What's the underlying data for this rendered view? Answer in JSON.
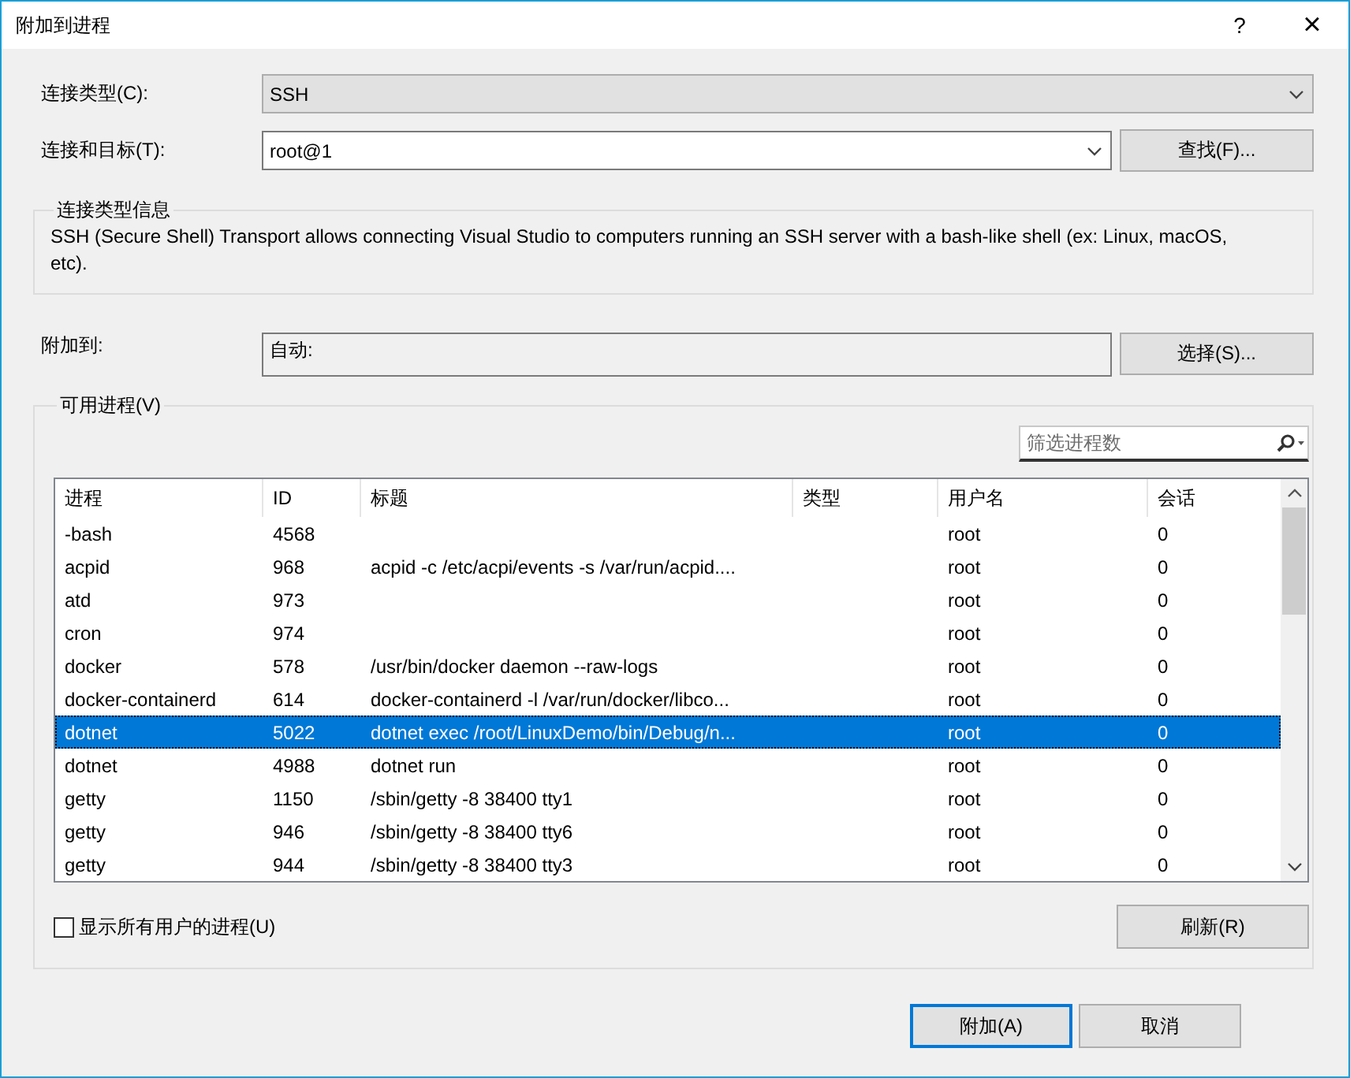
{
  "window": {
    "title": "附加到进程",
    "help": "?",
    "close": "×"
  },
  "connection_type": {
    "label": "连接类型(C):",
    "value": "SSH"
  },
  "connection_target": {
    "label": "连接和目标(T):",
    "value": "root@1",
    "button": "查找(F)..."
  },
  "info_group": {
    "title": "连接类型信息",
    "text": "SSH (Secure Shell) Transport allows connecting Visual Studio to computers running an SSH server with a bash-like shell (ex: Linux, macOS, etc)."
  },
  "attach_to": {
    "label": "附加到:",
    "value": "自动:",
    "button": "选择(S)..."
  },
  "processes_group": {
    "title": "可用进程(V)",
    "filter": {
      "placeholder": "筛选进程数"
    },
    "table": {
      "columns": [
        "进程",
        "ID",
        "标题",
        "类型",
        "用户名",
        "会话"
      ],
      "rows": [
        {
          "cells": [
            "-bash",
            "4568",
            "",
            "",
            "root",
            "0"
          ],
          "selected": false
        },
        {
          "cells": [
            "acpid",
            "968",
            "acpid -c /etc/acpi/events -s /var/run/acpid....",
            "",
            "root",
            "0"
          ],
          "selected": false
        },
        {
          "cells": [
            "atd",
            "973",
            "",
            "",
            "root",
            "0"
          ],
          "selected": false
        },
        {
          "cells": [
            "cron",
            "974",
            "",
            "",
            "root",
            "0"
          ],
          "selected": false
        },
        {
          "cells": [
            "docker",
            "578",
            "/usr/bin/docker daemon --raw-logs",
            "",
            "root",
            "0"
          ],
          "selected": false
        },
        {
          "cells": [
            "docker-containerd",
            "614",
            "docker-containerd -l /var/run/docker/libco...",
            "",
            "root",
            "0"
          ],
          "selected": false
        },
        {
          "cells": [
            "dotnet",
            "5022",
            "dotnet exec /root/LinuxDemo/bin/Debug/n...",
            "",
            "root",
            "0"
          ],
          "selected": true
        },
        {
          "cells": [
            "dotnet",
            "4988",
            "dotnet run",
            "",
            "root",
            "0"
          ],
          "selected": false
        },
        {
          "cells": [
            "getty",
            "1150",
            "/sbin/getty -8 38400 tty1",
            "",
            "root",
            "0"
          ],
          "selected": false
        },
        {
          "cells": [
            "getty",
            "946",
            "/sbin/getty -8 38400 tty6",
            "",
            "root",
            "0"
          ],
          "selected": false
        },
        {
          "cells": [
            "getty",
            "944",
            "/sbin/getty -8 38400 tty3",
            "",
            "root",
            "0"
          ],
          "selected": false
        }
      ]
    },
    "show_all_users": {
      "label": "显示所有用户的进程(U)",
      "checked": false
    },
    "refresh_button": "刷新(R)"
  },
  "buttons": [
    {
      "label": "附加(A)",
      "focused": true
    },
    {
      "label": "取消",
      "focused": false
    }
  ]
}
